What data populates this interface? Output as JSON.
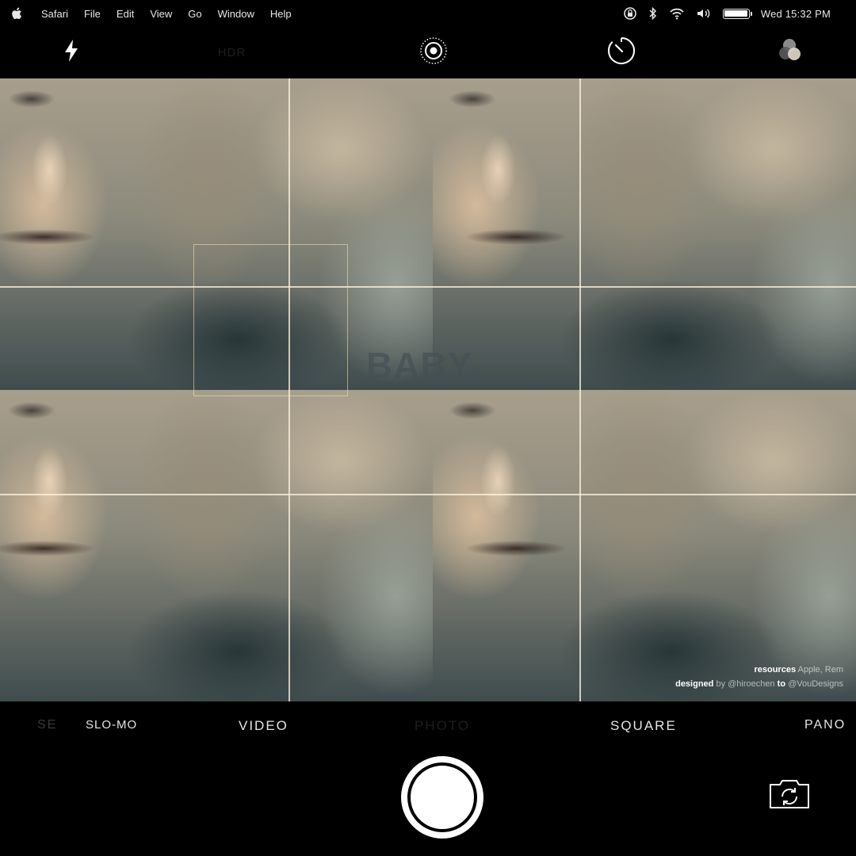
{
  "menubar": {
    "items": [
      "Safari",
      "File",
      "Edit",
      "View",
      "Go",
      "Window",
      "Help"
    ],
    "clock": "Wed 15:32  PM",
    "battery_level": 1.0
  },
  "camera_top": {
    "hdr_label": "HDR",
    "icons": [
      "flash-icon",
      "live-photo-icon",
      "timer-icon",
      "filters-icon"
    ]
  },
  "viewfinder": {
    "overlay_text": "BABY,",
    "credits": {
      "resources_label": "resources",
      "resources_value": "Apple, Rem",
      "designed_label": "designed",
      "designed_by": "by @hiroechen",
      "to_label": "to",
      "to_value": "@VouDesigns"
    }
  },
  "modes": {
    "timelapse": "SE",
    "slomo": "SLO-MO",
    "video": "VIDEO",
    "photo": "PHOTO",
    "square": "SQUARE",
    "pano": "PANO",
    "selected": "PHOTO"
  },
  "colors": {
    "background": "#000000",
    "text": "#e5e5e5",
    "gridline": "#fff5e1"
  }
}
